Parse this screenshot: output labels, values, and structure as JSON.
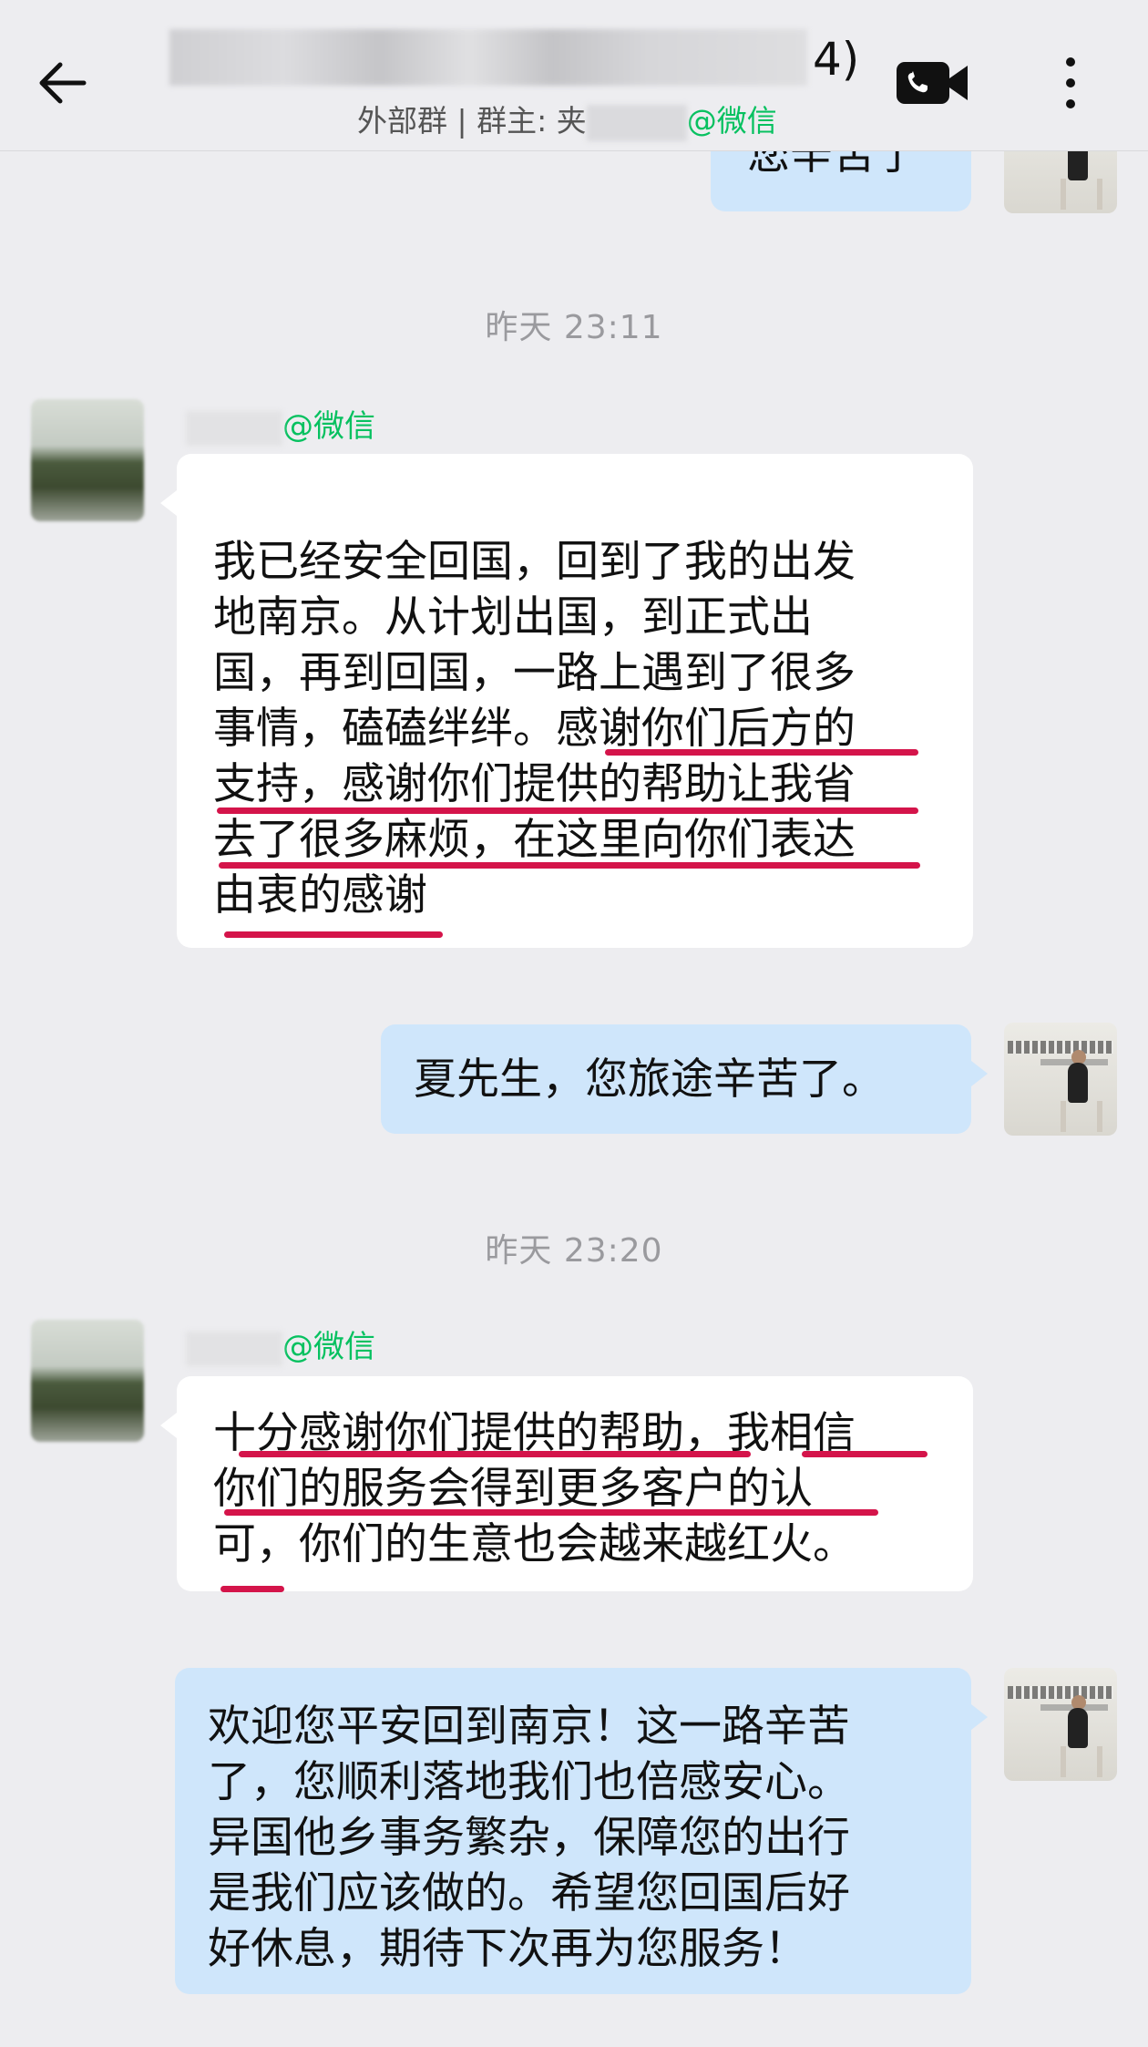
{
  "header": {
    "title_suffix": "4)",
    "subtitle_prefix": "外部群 | 群主: 夹",
    "subtitle_suffix": "@微信"
  },
  "top_partial_message": "您辛苦了",
  "timestamps": [
    "昨天 23:11",
    "昨天 23:20"
  ],
  "messages": [
    {
      "sender_suffix": "@微信",
      "text": "我已经安全回国，回到了我的出发\n地南京。从计划出国，到正式出\n国，再到回国，一路上遇到了很多\n事情，磕磕绊绊。感谢你们后方的\n支持，感谢你们提供的帮助让我省\n去了很多麻烦，在这里向你们表达\n由衷的感谢"
    },
    {
      "text": "夏先生，您旅途辛苦了。"
    },
    {
      "sender_suffix": "@微信",
      "text": "十分感谢你们提供的帮助，我相信\n你们的服务会得到更多客户的认\n可，你们的生意也会越来越红火。"
    },
    {
      "text": "欢迎您平安回到南京！这一路辛苦\n了，您顺利落地我们也倍感安心。\n异国他乡事务繁杂，保障您的出行\n是我们应该做的。希望您回国后好\n好休息，期待下次再为您服务！"
    }
  ],
  "icons": [
    "back-arrow-icon",
    "video-call-icon",
    "more-options-icon"
  ],
  "colors": {
    "wechat_green": "#07c160",
    "underline_red": "#d4144a",
    "outgoing_bubble": "#cfe6fb",
    "background": "#ededf0"
  }
}
